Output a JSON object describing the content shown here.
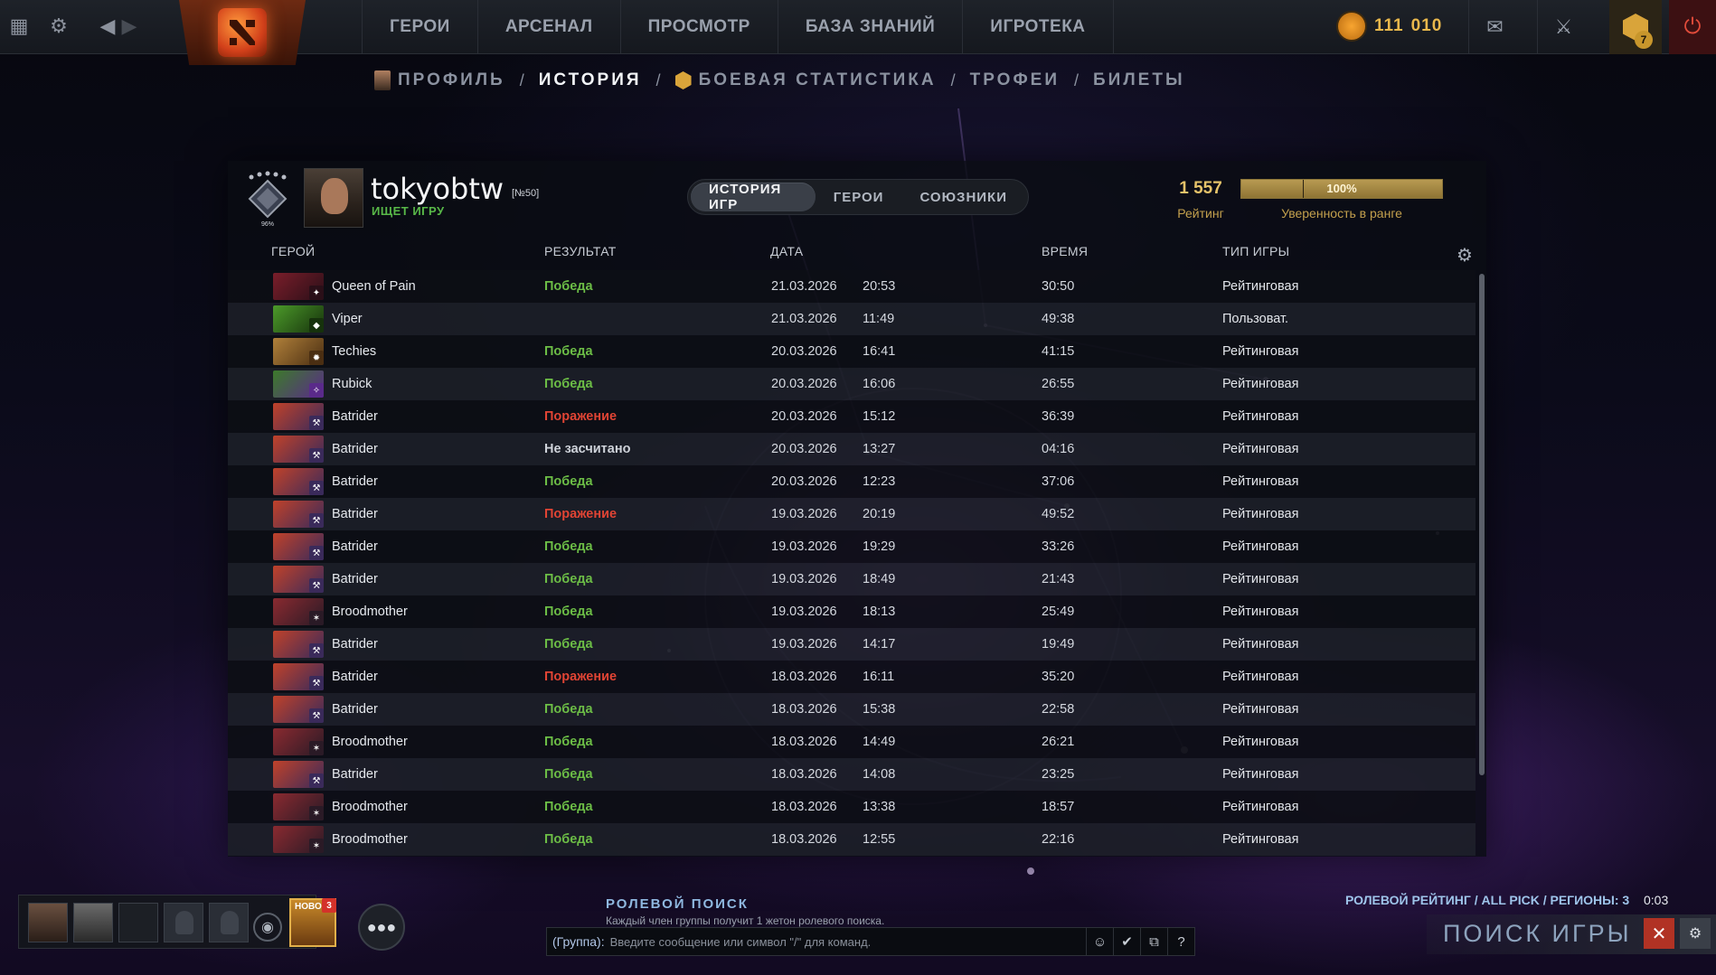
{
  "topbar": {
    "nav": [
      "ГЕРОИ",
      "АРСЕНАЛ",
      "ПРОСМОТР",
      "БАЗА ЗНАНИЙ",
      "ИГРОТЕКА"
    ],
    "currency_a": "111",
    "currency_b": "010",
    "plus_badge": "7"
  },
  "subnav": {
    "profile": "ПРОФИЛЬ",
    "history": "ИСТОРИЯ",
    "stats": "БОЕВАЯ СТАТИСТИКА",
    "trophies": "ТРОФЕИ",
    "tickets": "БИЛЕТЫ",
    "separator": "/"
  },
  "profile": {
    "medal_percent": "96%",
    "username": "tokyobtw",
    "level": "[№50]",
    "status": "ИЩЕТ ИГРУ",
    "rating_value": "1 557",
    "rating_label": "Рейтинг",
    "confidence_value": "100%",
    "confidence_fraction": 1.0,
    "confidence_label": "Уверенность в ранге"
  },
  "tabs": [
    "ИСТОРИЯ ИГР",
    "ГЕРОИ",
    "СОЮЗНИКИ"
  ],
  "columns": {
    "hero": "ГЕРОЙ",
    "result": "РЕЗУЛЬТАТ",
    "date": "ДАТА",
    "duration": "ВРЕМЯ",
    "type": "ТИП ИГРЫ"
  },
  "matches": [
    {
      "hero": "Queen of Pain",
      "result": "Победа",
      "outcome": "win",
      "date": "21.03.2026",
      "time": "20:53",
      "duration": "30:50",
      "type": "Рейтинговая"
    },
    {
      "hero": "Viper",
      "result": "",
      "outcome": "none",
      "date": "21.03.2026",
      "time": "11:49",
      "duration": "49:38",
      "type": "Пользоват."
    },
    {
      "hero": "Techies",
      "result": "Победа",
      "outcome": "win",
      "date": "20.03.2026",
      "time": "16:41",
      "duration": "41:15",
      "type": "Рейтинговая"
    },
    {
      "hero": "Rubick",
      "result": "Победа",
      "outcome": "win",
      "date": "20.03.2026",
      "time": "16:06",
      "duration": "26:55",
      "type": "Рейтинговая"
    },
    {
      "hero": "Batrider",
      "result": "Поражение",
      "outcome": "loss",
      "date": "20.03.2026",
      "time": "15:12",
      "duration": "36:39",
      "type": "Рейтинговая"
    },
    {
      "hero": "Batrider",
      "result": "Не засчитано",
      "outcome": "neutral",
      "date": "20.03.2026",
      "time": "13:27",
      "duration": "04:16",
      "type": "Рейтинговая"
    },
    {
      "hero": "Batrider",
      "result": "Победа",
      "outcome": "win",
      "date": "20.03.2026",
      "time": "12:23",
      "duration": "37:06",
      "type": "Рейтинговая"
    },
    {
      "hero": "Batrider",
      "result": "Поражение",
      "outcome": "loss",
      "date": "19.03.2026",
      "time": "20:19",
      "duration": "49:52",
      "type": "Рейтинговая"
    },
    {
      "hero": "Batrider",
      "result": "Победа",
      "outcome": "win",
      "date": "19.03.2026",
      "time": "19:29",
      "duration": "33:26",
      "type": "Рейтинговая"
    },
    {
      "hero": "Batrider",
      "result": "Победа",
      "outcome": "win",
      "date": "19.03.2026",
      "time": "18:49",
      "duration": "21:43",
      "type": "Рейтинговая"
    },
    {
      "hero": "Broodmother",
      "result": "Победа",
      "outcome": "win",
      "date": "19.03.2026",
      "time": "18:13",
      "duration": "25:49",
      "type": "Рейтинговая"
    },
    {
      "hero": "Batrider",
      "result": "Победа",
      "outcome": "win",
      "date": "19.03.2026",
      "time": "14:17",
      "duration": "19:49",
      "type": "Рейтинговая"
    },
    {
      "hero": "Batrider",
      "result": "Поражение",
      "outcome": "loss",
      "date": "18.03.2026",
      "time": "16:11",
      "duration": "35:20",
      "type": "Рейтинговая"
    },
    {
      "hero": "Batrider",
      "result": "Победа",
      "outcome": "win",
      "date": "18.03.2026",
      "time": "15:38",
      "duration": "22:58",
      "type": "Рейтинговая"
    },
    {
      "hero": "Broodmother",
      "result": "Победа",
      "outcome": "win",
      "date": "18.03.2026",
      "time": "14:49",
      "duration": "26:21",
      "type": "Рейтинговая"
    },
    {
      "hero": "Batrider",
      "result": "Победа",
      "outcome": "win",
      "date": "18.03.2026",
      "time": "14:08",
      "duration": "23:25",
      "type": "Рейтинговая"
    },
    {
      "hero": "Broodmother",
      "result": "Победа",
      "outcome": "win",
      "date": "18.03.2026",
      "time": "13:38",
      "duration": "18:57",
      "type": "Рейтинговая"
    },
    {
      "hero": "Broodmother",
      "result": "Победа",
      "outcome": "win",
      "date": "18.03.2026",
      "time": "12:55",
      "duration": "22:16",
      "type": "Рейтинговая"
    }
  ],
  "hero_colors": {
    "Queen of Pain": [
      "#7a1e2a",
      "#2a0f18"
    ],
    "Viper": [
      "#4c9a2a",
      "#16320c"
    ],
    "Techies": [
      "#b0803a",
      "#4a2e12"
    ],
    "Rubick": [
      "#3c7a2a",
      "#5a2a8a"
    ],
    "Batrider": [
      "#c0422a",
      "#3a2a5a"
    ],
    "Broodmother": [
      "#8a2a30",
      "#2a1a26"
    ]
  },
  "bottom": {
    "news_label": "НОВО",
    "news_count": "3",
    "role_title": "РОЛЕВОЙ ПОИСК",
    "role_sub": "Каждый член группы получит 1 жетон ролевого поиска.",
    "chat_tag": "(Группа):",
    "chat_placeholder": "Введите сообщение или символ \"/\" для команд.",
    "chat_help": "?",
    "mm_label": "РОЛЕВОЙ РЕЙТИНГ / ALL PICK / РЕГИОНЫ: 3",
    "mm_timer": "0:03",
    "mm_text": "ПОИСК ИГРЫ"
  },
  "colors": {
    "win": "#6cbd46",
    "loss": "#e04434",
    "accent_gold": "#e6c36a"
  }
}
